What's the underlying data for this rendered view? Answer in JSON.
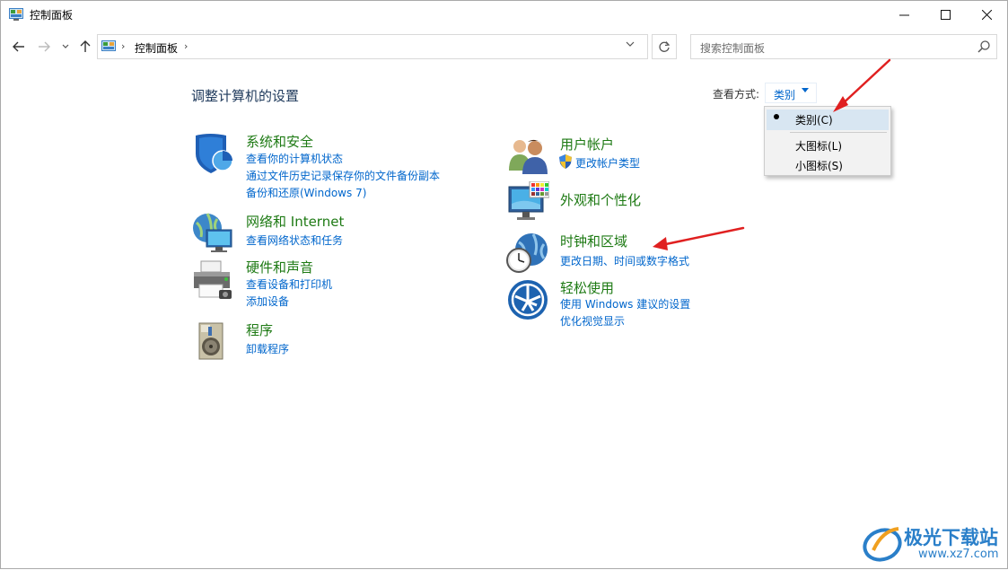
{
  "window": {
    "title": "控制面板"
  },
  "nav": {
    "address": "控制面板",
    "search_placeholder": "搜索控制面板"
  },
  "content": {
    "heading": "调整计算机的设置",
    "view_by_label": "查看方式:",
    "view_by_value": "类别"
  },
  "categories": {
    "system_security": {
      "title": "系统和安全",
      "links": [
        "查看你的计算机状态",
        "通过文件历史记录保存你的文件备份副本",
        "备份和还原(Windows 7)"
      ]
    },
    "network": {
      "title": "网络和 Internet",
      "links": [
        "查看网络状态和任务"
      ]
    },
    "hardware": {
      "title": "硬件和声音",
      "links": [
        "查看设备和打印机",
        "添加设备"
      ]
    },
    "programs": {
      "title": "程序",
      "links": [
        "卸载程序"
      ]
    },
    "user_accounts": {
      "title": "用户帐户",
      "links": [
        "更改帐户类型"
      ]
    },
    "appearance": {
      "title": "外观和个性化",
      "links": []
    },
    "clock_region": {
      "title": "时钟和区域",
      "links": [
        "更改日期、时间或数字格式"
      ]
    },
    "ease_access": {
      "title": "轻松使用",
      "links": [
        "使用 Windows 建议的设置",
        "优化视觉显示"
      ]
    }
  },
  "view_menu": {
    "items": [
      "类别(C)",
      "大图标(L)",
      "小图标(S)"
    ],
    "selected": "类别(C)"
  },
  "watermark": {
    "text": "极光下载站",
    "url": "www.xz7.com"
  },
  "colors": {
    "link": "#0066cc",
    "category_title": "#1e7a14",
    "heading": "#1e395b",
    "annotation_arrow": "#e02020"
  }
}
